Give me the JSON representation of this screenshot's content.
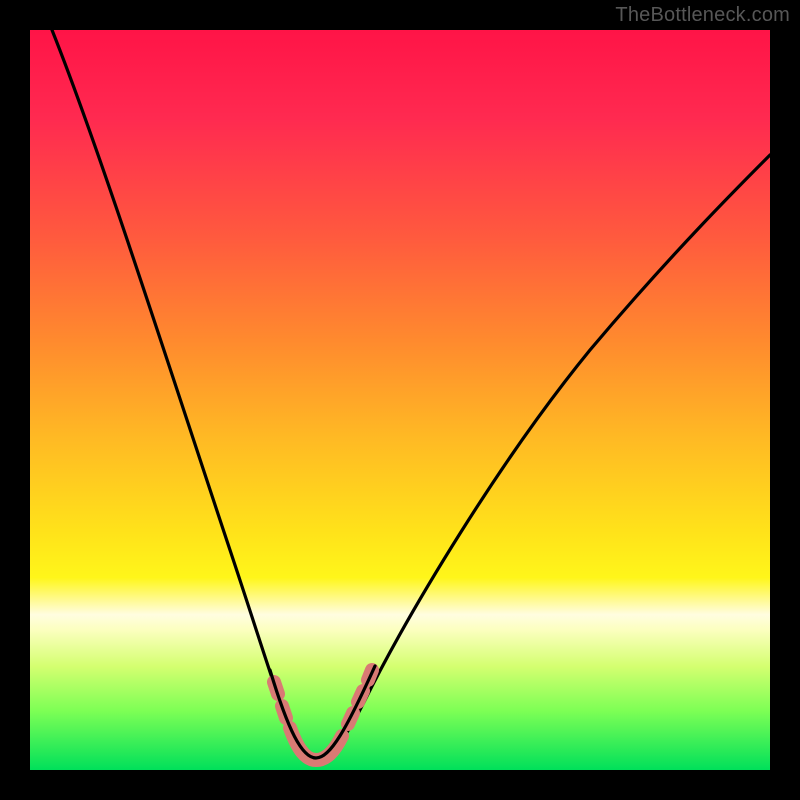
{
  "attribution": "TheBottleneck.com",
  "chart_data": {
    "type": "line",
    "title": "",
    "xlabel": "",
    "ylabel": "",
    "xlim": [
      0,
      100
    ],
    "ylim": [
      0,
      100
    ],
    "grid": false,
    "legend": false,
    "series": [
      {
        "name": "bottleneck-curve",
        "x": [
          3,
          8,
          12,
          16,
          20,
          24,
          27,
          29,
          31,
          32.5,
          34,
          35.5,
          37,
          38,
          39.5,
          42,
          46,
          52,
          58,
          65,
          72,
          80,
          88,
          96,
          100
        ],
        "y": [
          100,
          87,
          76,
          65,
          54,
          43,
          33,
          26,
          19,
          13,
          8,
          4,
          2,
          2,
          3,
          6,
          11,
          19,
          27,
          35,
          43,
          51,
          58,
          65,
          68
        ]
      },
      {
        "name": "bottom-marker-band",
        "x": [
          31,
          32,
          33,
          34,
          35,
          36,
          37,
          38,
          39,
          40,
          41,
          42,
          43,
          44,
          45
        ],
        "y": [
          13,
          9,
          6,
          4,
          3,
          2.5,
          2,
          2.5,
          3,
          4,
          5.5,
          7,
          9,
          11,
          13
        ]
      }
    ],
    "colors": {
      "curve": "#000000",
      "marker": "#d97a74",
      "gradient_top": "#ff1648",
      "gradient_mid": "#ffe31a",
      "gradient_bottom": "#00e05a"
    }
  }
}
